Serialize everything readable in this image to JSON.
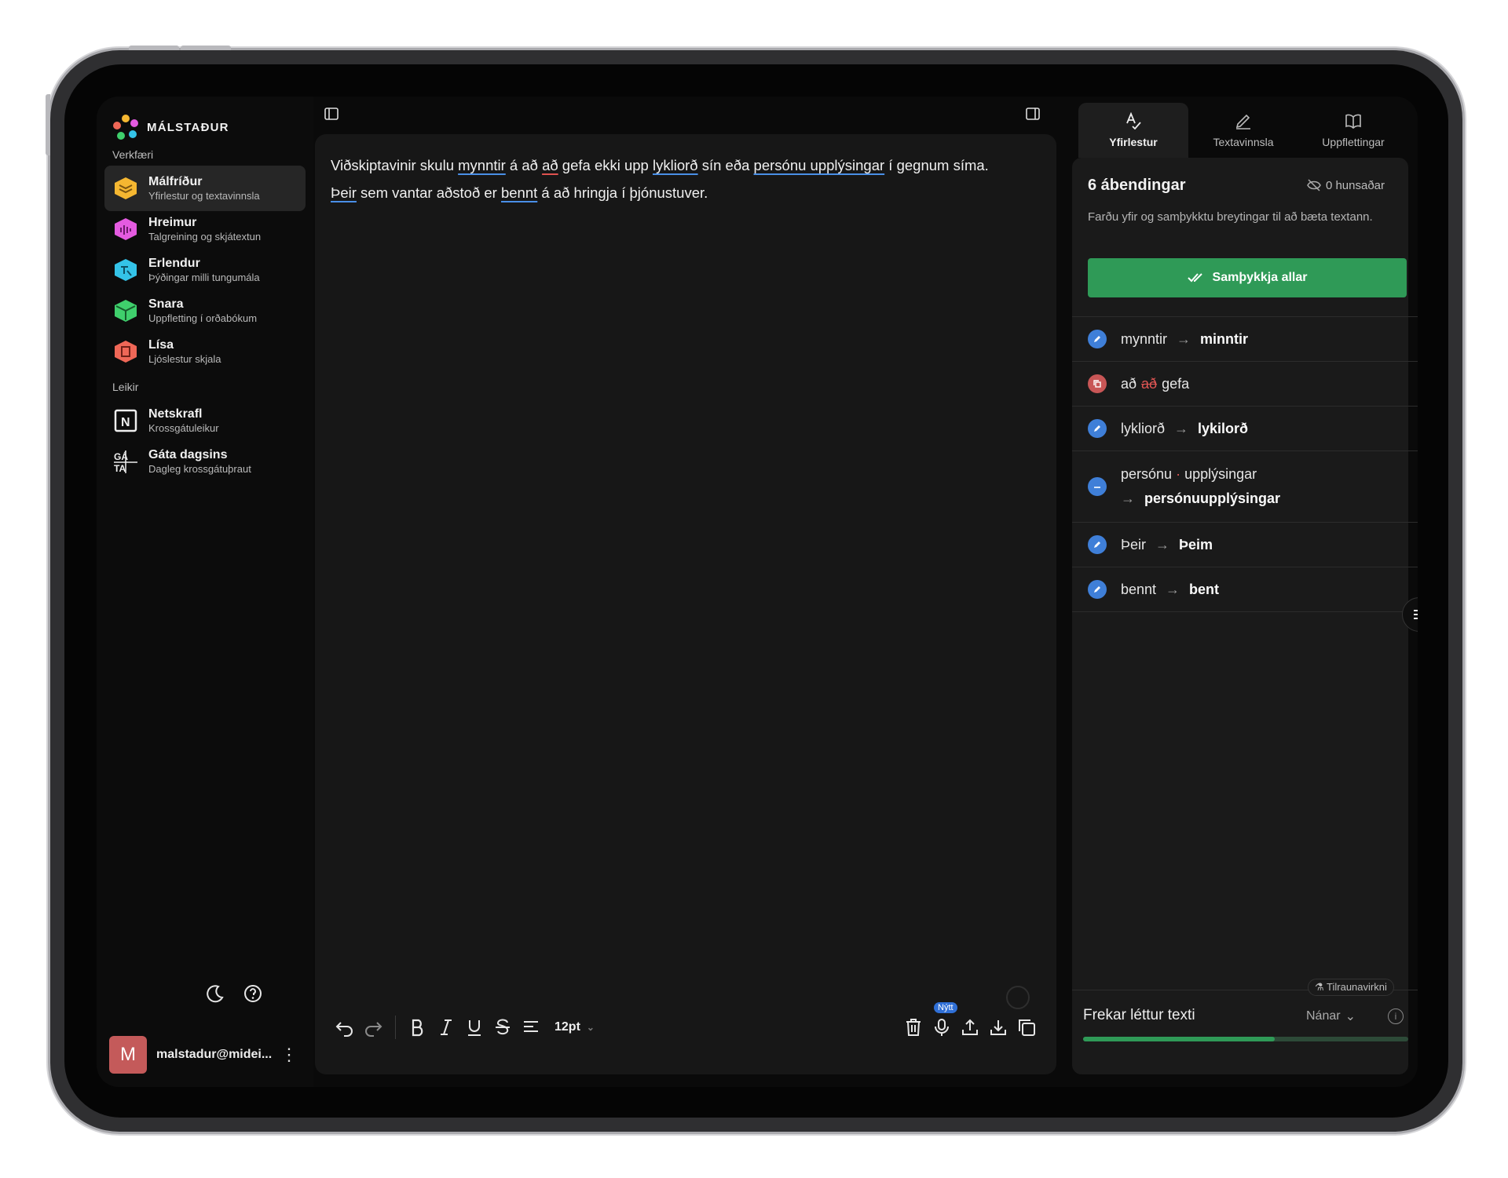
{
  "app": {
    "name": "MÁLSTAÐUR"
  },
  "sidebar": {
    "tools_label": "Verkfæri",
    "tools": [
      {
        "title": "Málfríður",
        "subtitle": "Yfirlestur og textavinnsla",
        "color": "#f5b731",
        "active": true
      },
      {
        "title": "Hreimur",
        "subtitle": "Talgreining og skjátextun",
        "color": "#e45be0"
      },
      {
        "title": "Erlendur",
        "subtitle": "Þýðingar milli tungumála",
        "color": "#34c3e8"
      },
      {
        "title": "Snara",
        "subtitle": "Uppfletting í orðabókum",
        "color": "#3fcf6c"
      },
      {
        "title": "Lísa",
        "subtitle": "Ljóslestur skjala",
        "color": "#ef6757"
      }
    ],
    "games_label": "Leikir",
    "games": [
      {
        "title": "Netskrafl",
        "subtitle": "Krossgátuleikur",
        "icon": "N"
      },
      {
        "title": "Gáta dagsins",
        "subtitle": "Dagleg krossgátuþraut",
        "icon": "GÁTA"
      }
    ],
    "user": {
      "initial": "M",
      "email": "malstadur@midei..."
    }
  },
  "editor": {
    "font_size": "12pt",
    "new_badge": "Nýtt",
    "line1": {
      "p1": "Viðskiptavinir skulu ",
      "w1": "mynntir",
      "p2": " á að ",
      "w2": "að",
      "p3": " gefa ekki upp ",
      "w3": "lykliorð",
      "p4": " sín eða ",
      "w4": "persónu upplýsingar",
      "p5": " í gegnum síma."
    },
    "line2": {
      "w1": "Þeir",
      "p1": " sem vantar aðstoð er ",
      "w2": "bennt",
      "p2": " á að hringja í þjónustuver."
    }
  },
  "right_panel": {
    "tabs": [
      {
        "label": "Yfirlestur",
        "icon": "spellcheck-icon",
        "active": true
      },
      {
        "label": "Textavinnsla",
        "icon": "pen-icon"
      },
      {
        "label": "Uppflettingar",
        "icon": "book-icon"
      }
    ],
    "count": "6 ábendingar",
    "ignored": "0 hunsaðar",
    "hint": "Farðu yfir og samþykktu breytingar til að bæta textann.",
    "accept_all": "Samþykkja allar",
    "suggestions": [
      {
        "from": "mynntir",
        "to": "minntir",
        "type": "edit"
      },
      {
        "from_a": "að",
        "from_del": "að",
        "from_b": "gefa",
        "type": "delete"
      },
      {
        "from": "lykliorð",
        "to": "lykilorð",
        "type": "edit"
      },
      {
        "from_a": "persónu",
        "from_b": "upplýsingar",
        "to": "persónuupplýsingar",
        "type": "join"
      },
      {
        "from": "Þeir",
        "to": "Þeim",
        "type": "edit"
      },
      {
        "from": "bennt",
        "to": "bent",
        "type": "edit"
      }
    ],
    "experimental": "Tilraunavirkni",
    "readability_title": "Frekar léttur texti",
    "readability_more": "Nánar",
    "readability_value": 0.59
  }
}
